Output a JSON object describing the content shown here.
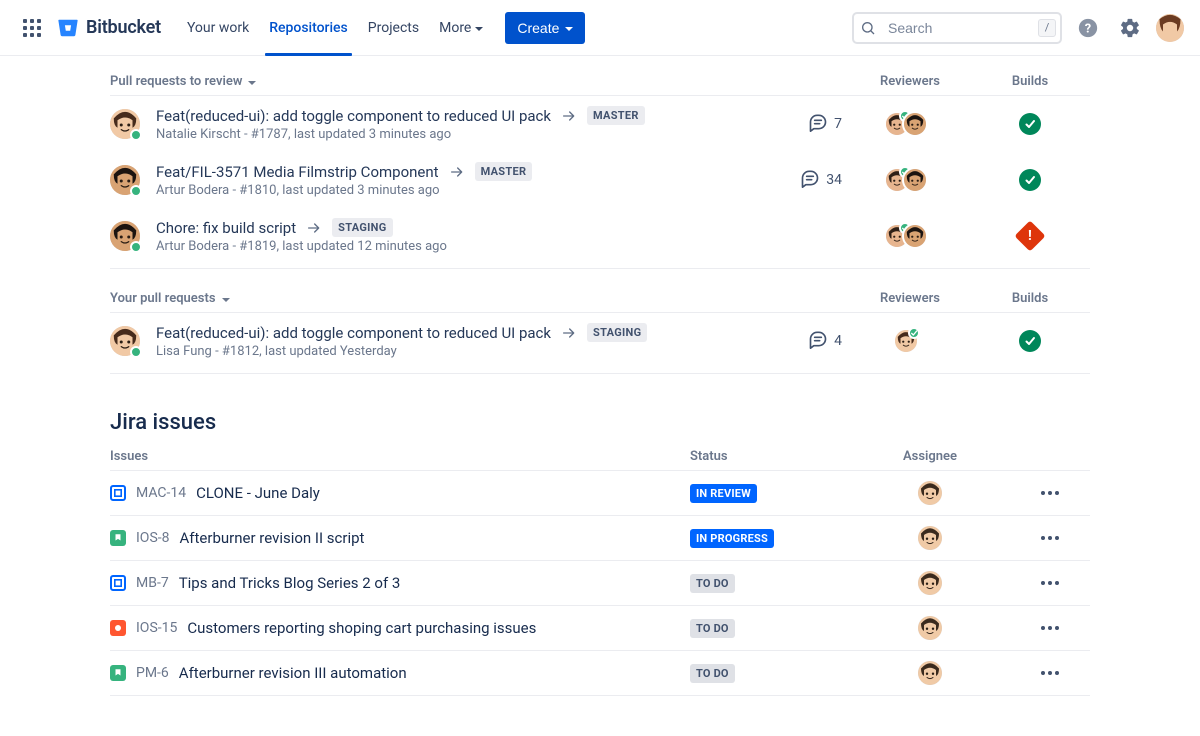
{
  "nav": {
    "product": "Bitbucket",
    "links": [
      {
        "label": "Your work",
        "active": false
      },
      {
        "label": "Repositories",
        "active": true
      },
      {
        "label": "Projects",
        "active": false
      },
      {
        "label": "More",
        "active": false,
        "caret": true
      }
    ],
    "create_label": "Create",
    "search_placeholder": "Search",
    "search_shortcut": "/"
  },
  "prs_review": {
    "title": "Pull requests to review",
    "col_reviewers": "Reviewers",
    "col_builds": "Builds",
    "rows": [
      {
        "title": "Feat(reduced-ui): add toggle component to reduced UI pack",
        "branch": "MASTER",
        "sub": "Natalie Kirscht - #1787, last updated  3 minutes ago",
        "comments": "7",
        "build": "ok"
      },
      {
        "title": "Feat/FIL-3571 Media Filmstrip Component",
        "branch": "MASTER",
        "sub": "Artur Bodera - #1810, last updated 3 minutes ago",
        "comments": "34",
        "build": "ok"
      },
      {
        "title": "Chore: fix build script",
        "branch": "STAGING",
        "sub": "Artur Bodera - #1819, last updated  12 minutes ago",
        "comments": "",
        "build": "fail"
      }
    ]
  },
  "prs_yours": {
    "title": "Your pull requests",
    "col_reviewers": "Reviewers",
    "col_builds": "Builds",
    "rows": [
      {
        "title": "Feat(reduced-ui): add toggle component to reduced UI pack",
        "branch": "STAGING",
        "sub": "Lisa Fung - #1812, last updated Yesterday",
        "comments": "4",
        "build": "ok"
      }
    ]
  },
  "jira": {
    "heading": "Jira issues",
    "col_issues": "Issues",
    "col_status": "Status",
    "col_assignee": "Assignee",
    "rows": [
      {
        "key": "MAC-14",
        "summary": "CLONE - June Daly",
        "status": "IN REVIEW",
        "status_kind": "review",
        "type": "story-border"
      },
      {
        "key": "IOS-8",
        "summary": "Afterburner revision II script",
        "status": "IN PROGRESS",
        "status_kind": "progress",
        "type": "story"
      },
      {
        "key": "MB-7",
        "summary": "Tips and Tricks Blog Series 2 of 3",
        "status": "TO DO",
        "status_kind": "todo",
        "type": "story-border"
      },
      {
        "key": "IOS-15",
        "summary": "Customers reporting shoping cart purchasing issues",
        "status": "TO DO",
        "status_kind": "todo",
        "type": "bug"
      },
      {
        "key": "PM-6",
        "summary": "Afterburner revision III automation",
        "status": "TO DO",
        "status_kind": "todo",
        "type": "story"
      }
    ]
  },
  "avatar_palettes": {
    "a": {
      "skin": "#e7b58f",
      "hair": "#2f2017"
    },
    "b": {
      "skin": "#d9a373",
      "hair": "#1c1410"
    },
    "c": {
      "skin": "#f1c9a5",
      "hair": "#462b1c"
    },
    "d": {
      "skin": "#e3b08a",
      "hair": "#6b3b22"
    },
    "e": {
      "skin": "#f0caa6",
      "hair": "#3a2a1d"
    }
  },
  "build_fail_glyph": "!"
}
